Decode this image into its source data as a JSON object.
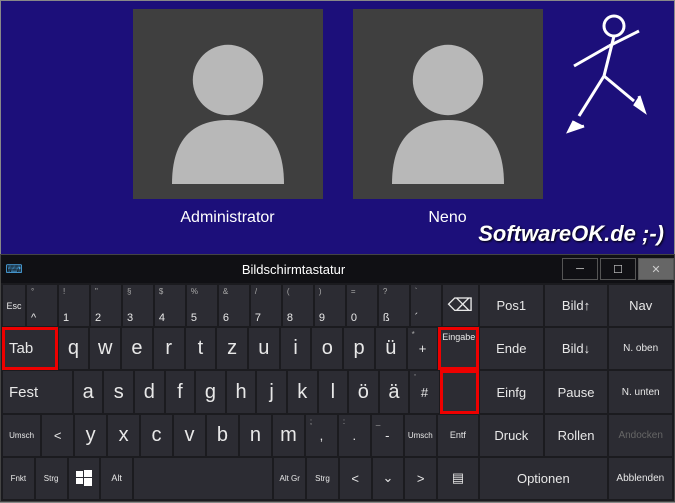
{
  "users": [
    {
      "name": "Administrator"
    },
    {
      "name": "Neno"
    }
  ],
  "watermark": "SoftwareOK.de ;-)",
  "osk": {
    "title": "Bildschirmtastatur",
    "row0": {
      "esc": "Esc",
      "keys": [
        {
          "sup": "!",
          "main": "1"
        },
        {
          "sup": "\"",
          "main": "2"
        },
        {
          "sup": "§",
          "main": "3"
        },
        {
          "sup": "$",
          "main": "4"
        },
        {
          "sup": "%",
          "main": "5"
        },
        {
          "sup": "&",
          "main": "6"
        },
        {
          "sup": "/",
          "main": "7"
        },
        {
          "sup": "(",
          "main": "8"
        },
        {
          "sup": ")",
          "main": "9"
        },
        {
          "sup": "=",
          "main": "0"
        },
        {
          "sup": "?",
          "main": "ß"
        },
        {
          "sup": "`",
          "main": "´"
        }
      ],
      "backspace": "⌫"
    },
    "row1": {
      "tab": "Tab",
      "keys": [
        "q",
        "w",
        "e",
        "r",
        "t",
        "z",
        "u",
        "i",
        "o",
        "p",
        "ü"
      ],
      "plus": "+",
      "enter": "Eingabe"
    },
    "row2": {
      "caps": "Fest",
      "keys": [
        "a",
        "s",
        "d",
        "f",
        "g",
        "h",
        "j",
        "k",
        "l",
        "ö",
        "ä"
      ],
      "hash": "#"
    },
    "row3": {
      "shift": "Umsch",
      "lt": "<",
      "keys": [
        "y",
        "x",
        "c",
        "v",
        "b",
        "n",
        "m"
      ],
      "comma": ",",
      "dot": ".",
      "dash": "-",
      "shift2": "Umsch",
      "del": "Entf"
    },
    "row4": {
      "fn": "Fnkt",
      "ctrl": "Strg",
      "win": "⊞",
      "alt": "Alt",
      "altgr": "Alt Gr",
      "ctrl2": "Strg",
      "left": "<",
      "down": "⌄",
      "right": ">",
      "menu": "▤"
    },
    "side": {
      "pos1": "Pos1",
      "pgup": "Bild↑",
      "nav": "Nav",
      "end": "Ende",
      "pgdn": "Bild↓",
      "nup": "N. oben",
      "ins": "Einfg",
      "pause": "Pause",
      "ndn": "N. unten",
      "print": "Druck",
      "scroll": "Rollen",
      "dock": "Andocken",
      "options": "Optionen",
      "fade": "Abblenden"
    }
  }
}
